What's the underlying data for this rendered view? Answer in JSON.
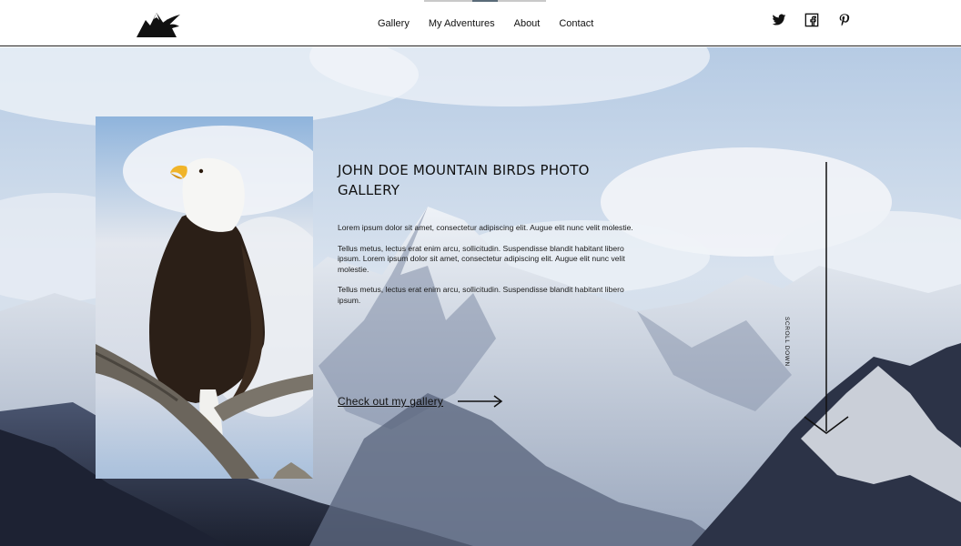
{
  "header": {
    "logo_alt": "mountain-bird-logo",
    "nav": [
      {
        "label": "Gallery"
      },
      {
        "label": "My Adventures"
      },
      {
        "label": "About"
      },
      {
        "label": "Contact"
      }
    ],
    "social": [
      "twitter-icon",
      "facebook-icon",
      "pinterest-icon"
    ]
  },
  "hero": {
    "title": "JOHN DOE MOUNTAIN BIRDS PHOTO GALLERY",
    "paragraphs": [
      "Lorem ipsum dolor sit amet, consectetur adipiscing elit. Augue elit nunc velit molestie.",
      "Tellus metus, lectus erat enim arcu, sollicitudin. Suspendisse blandit habitant libero ipsum. Lorem ipsum dolor sit amet, consectetur adipiscing elit. Augue elit nunc velit molestie.",
      "Tellus metus, lectus erat enim arcu, sollicitudin. Suspendisse blandit habitant libero ipsum."
    ],
    "cta_label": "Check out my gallery",
    "scroll_label": "SCROLL DOWN"
  },
  "colors": {
    "header_bg": "#ffffff",
    "text": "#111111",
    "accent_line": "#5a6b78"
  }
}
